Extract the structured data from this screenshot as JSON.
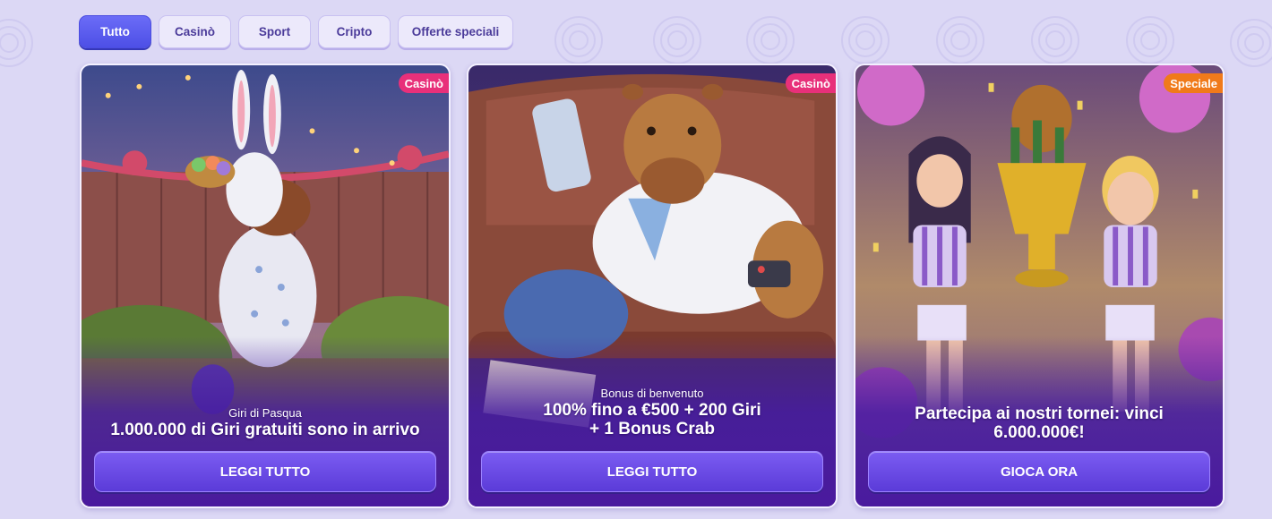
{
  "filters": [
    {
      "label": "Tutto",
      "active": true
    },
    {
      "label": "Casinò",
      "active": false
    },
    {
      "label": "Sport",
      "active": false
    },
    {
      "label": "Cripto",
      "active": false
    },
    {
      "label": "Offerte speciali",
      "active": false
    }
  ],
  "cards": [
    {
      "badge": "Casinò",
      "badge_color": "#e8307a",
      "subtitle": "Giri di Pasqua",
      "headline": "1.000.000 di Giri gratuiti sono in arrivo",
      "cta": "LEGGI TUTTO",
      "image": "easter-capybara-illustration"
    },
    {
      "badge": "Casinò",
      "badge_color": "#e8307a",
      "subtitle": "Bonus di benvenuto",
      "headline_line1": "100% fino a €500 + 200 Giri",
      "headline_line2": "+ 1 Bonus Crab",
      "cta": "LEGGI TUTTO",
      "image": "capybara-on-couch-illustration"
    },
    {
      "badge": "Speciale",
      "badge_color": "#f07a1a",
      "headline_line1": "Partecipa ai nostri tornei: vinci",
      "headline_line2": "6.000.000€!",
      "cta": "GIOCA ORA",
      "image": "cheerleaders-trophy-illustration"
    }
  ],
  "colors": {
    "page_background": "#dcd8f5",
    "filter_active": "#5a5cf0",
    "cta_button": "#6a4be6",
    "card_shade": "#4a1a9e"
  }
}
